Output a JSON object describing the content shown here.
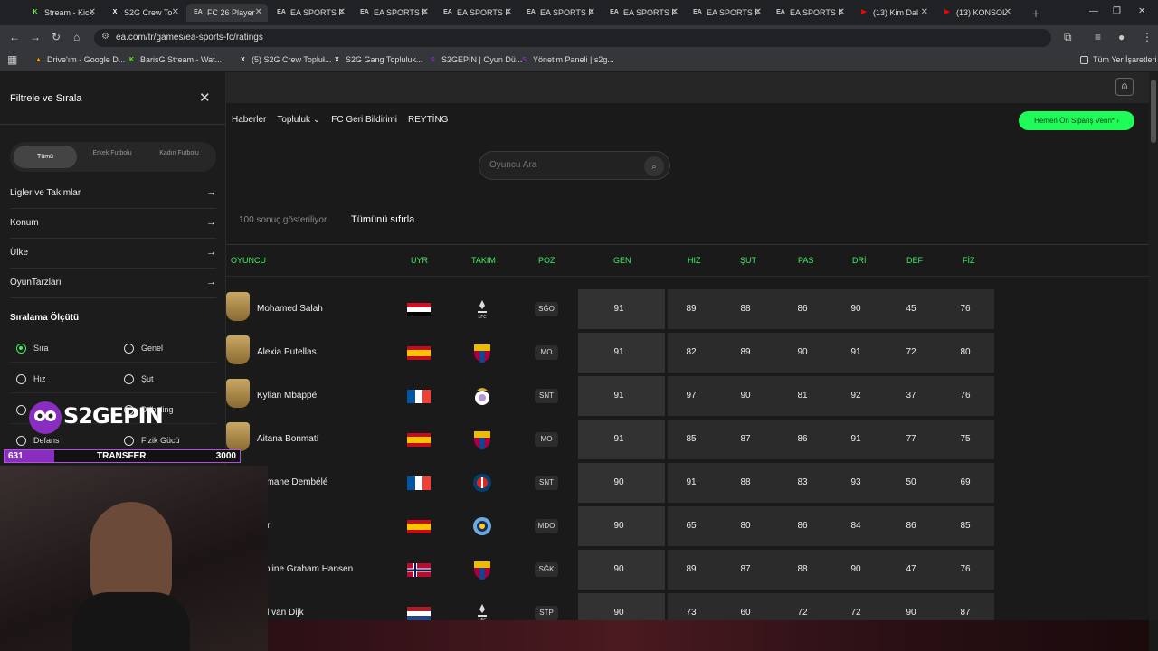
{
  "browser": {
    "tabs": [
      {
        "label": "Stream - Kick",
        "icon": "kick-icon",
        "color": "#53fc18",
        "glyph": "K"
      },
      {
        "label": "S2G Crew To",
        "icon": "x-icon",
        "color": "#ffffff",
        "glyph": "X"
      },
      {
        "label": "FC 26 Player",
        "icon": "ea-icon",
        "color": "#cccccc",
        "glyph": "EA"
      },
      {
        "label": "EA SPORTS F",
        "icon": "ea-icon",
        "color": "#cccccc",
        "glyph": "EA"
      },
      {
        "label": "EA SPORTS F",
        "icon": "ea-icon",
        "color": "#cccccc",
        "glyph": "EA"
      },
      {
        "label": "EA SPORTS F",
        "icon": "ea-icon",
        "color": "#cccccc",
        "glyph": "EA"
      },
      {
        "label": "EA SPORTS F",
        "icon": "ea-icon",
        "color": "#cccccc",
        "glyph": "EA"
      },
      {
        "label": "EA SPORTS F",
        "icon": "ea-icon",
        "color": "#cccccc",
        "glyph": "EA"
      },
      {
        "label": "EA SPORTS F",
        "icon": "ea-icon",
        "color": "#cccccc",
        "glyph": "EA"
      },
      {
        "label": "EA SPORTS F",
        "icon": "ea-icon",
        "color": "#cccccc",
        "glyph": "EA"
      },
      {
        "label": "(13) Kim Dal",
        "icon": "youtube-icon",
        "color": "#ff0000",
        "glyph": "▶"
      },
      {
        "label": "(13) KONSOL",
        "icon": "youtube-icon",
        "color": "#ff0000",
        "glyph": "▶"
      }
    ],
    "active_tab": 2,
    "url": "ea.com/tr/games/ea-sports-fc/ratings",
    "bookmarks": [
      {
        "label": "Drive'ım - Google D...",
        "icon": "google-drive-icon",
        "color": "#f4b400",
        "glyph": "▲"
      },
      {
        "label": "BarisG Stream - Wat...",
        "icon": "kick-icon",
        "color": "#53fc18",
        "glyph": "K"
      },
      {
        "label": "(5) S2G Crew Topluł...",
        "icon": "x-icon",
        "color": "#ffffff",
        "glyph": "X"
      },
      {
        "label": "S2G Gang Topluluk...",
        "icon": "x-icon",
        "color": "#ffffff",
        "glyph": "X"
      },
      {
        "label": "S2GEPIN | Oyun Dü...",
        "icon": "s2gepin-icon",
        "color": "#8a2ec2",
        "glyph": "S"
      },
      {
        "label": "Yönetim Paneli | s2g...",
        "icon": "s2gepin-icon",
        "color": "#8a2ec2",
        "glyph": "S"
      }
    ],
    "all_bookmarks": "Tüm Yer İşaretleri"
  },
  "sidebar": {
    "title": "Filtrele ve Sırala",
    "segments": [
      {
        "label": "Tümü"
      },
      {
        "label": "Erkek Futbolu"
      },
      {
        "label": "Kadın Futbolu"
      }
    ],
    "filters": [
      {
        "label": "Ligler ve Takımlar"
      },
      {
        "label": "Konum"
      },
      {
        "label": "Ülke"
      },
      {
        "label": "OyunTarzları"
      }
    ],
    "sort_heading": "Sıralama Ölçütü",
    "sort_options": [
      {
        "label": "Sıra",
        "selected": true
      },
      {
        "label": "Genel",
        "selected": false
      },
      {
        "label": "Hız",
        "selected": false
      },
      {
        "label": "Şut",
        "selected": false
      },
      {
        "label": "Pas",
        "selected": false
      },
      {
        "label": "Dribbling",
        "selected": false
      },
      {
        "label": "Defans",
        "selected": false
      },
      {
        "label": "Fizik Gücü",
        "selected": false
      }
    ]
  },
  "page": {
    "nav": [
      "Haberler",
      "Topluluk",
      "FC Geri Bildirimi",
      "REYTİNG"
    ],
    "cta": "Hemen Ön Sipariş Verin*",
    "search_placeholder": "Oyuncu Ara",
    "results_text": "100 sonuç gösteriliyor",
    "reset_text": "Tümünü sıfırla"
  },
  "table": {
    "headers": [
      "OYUNCU",
      "UYR",
      "TAKIM",
      "POZ",
      "GEN",
      "HIZ",
      "ŞUT",
      "PAS",
      "DRİ",
      "DEF",
      "FİZ"
    ],
    "rows": [
      {
        "name": "Mohamed Salah",
        "flag": "egypt",
        "club": "liverpool",
        "pos": "SĞO",
        "gen": "91",
        "stats": [
          "89",
          "88",
          "86",
          "90",
          "45",
          "76"
        ]
      },
      {
        "name": "Alexia Putellas",
        "flag": "spain",
        "club": "barcelona",
        "pos": "MO",
        "gen": "91",
        "stats": [
          "82",
          "89",
          "90",
          "91",
          "72",
          "80"
        ]
      },
      {
        "name": "Kylian Mbappé",
        "flag": "france",
        "club": "real-madrid",
        "pos": "SNT",
        "gen": "91",
        "stats": [
          "97",
          "90",
          "81",
          "92",
          "37",
          "76"
        ]
      },
      {
        "name": "Aitana Bonmatí",
        "flag": "spain",
        "club": "barcelona",
        "pos": "MO",
        "gen": "91",
        "stats": [
          "85",
          "87",
          "86",
          "91",
          "77",
          "75"
        ]
      },
      {
        "name": "usmane Dembélé",
        "flag": "france",
        "club": "psg",
        "pos": "SNT",
        "gen": "90",
        "stats": [
          "91",
          "88",
          "83",
          "93",
          "50",
          "69"
        ]
      },
      {
        "name": "odri",
        "flag": "spain",
        "club": "man-city",
        "pos": "MDO",
        "gen": "90",
        "stats": [
          "65",
          "80",
          "86",
          "84",
          "86",
          "85"
        ]
      },
      {
        "name": "aroline Graham Hansen",
        "flag": "norway",
        "club": "barcelona",
        "pos": "SĞK",
        "gen": "90",
        "stats": [
          "89",
          "87",
          "88",
          "90",
          "47",
          "76"
        ]
      },
      {
        "name": "rgil van Dijk",
        "flag": "netherlands",
        "club": "liverpool",
        "pos": "STP",
        "gen": "90",
        "stats": [
          "73",
          "60",
          "72",
          "72",
          "90",
          "87"
        ]
      }
    ]
  },
  "overlay": {
    "logo_text": "S2GEPIN",
    "transfer_current": "631",
    "transfer_label": "TRANSFER",
    "transfer_goal": "3000",
    "transfer_progress": 0.21
  },
  "colors": {
    "accent_green": "#3cf060",
    "cta_green": "#1ffc5a",
    "brand_purple": "#8a2ec2"
  }
}
